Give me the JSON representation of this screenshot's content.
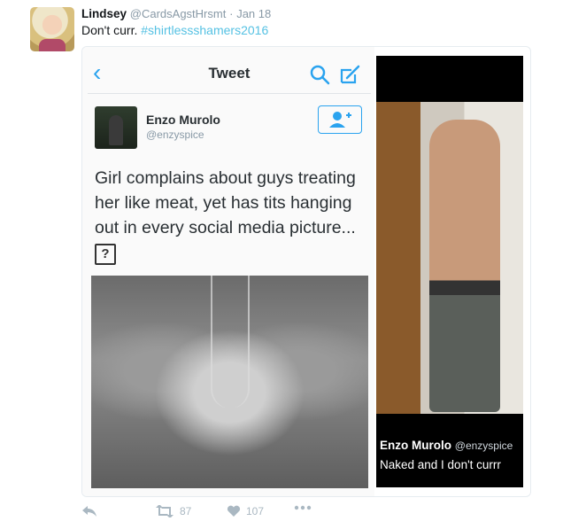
{
  "tweet": {
    "author_name": "Lindsey",
    "author_handle": "@CardsAgstHrsmt",
    "separator": "·",
    "date": "Jan 18",
    "text": "Don't curr.",
    "hashtag": "#shirtlessshamers2016"
  },
  "embedded_left": {
    "nav_title": "Tweet",
    "user_name": "Enzo Murolo",
    "user_handle": "@enzyspice",
    "body": "Girl complains about guys treating her like meat, yet has tits hanging out in every social media picture...",
    "placeholder_glyph": "?"
  },
  "embedded_right": {
    "user_name": "Enzo Murolo",
    "user_handle": "@enzyspice",
    "caption": "Naked and I don't currr"
  },
  "actions": {
    "retweets": "87",
    "likes": "107"
  },
  "colors": {
    "accent": "#2aa3ef",
    "hashtag": "#55c1e3",
    "muted": "#8899a6"
  },
  "icons": [
    "reply-icon",
    "retweet-icon",
    "heart-icon",
    "more-icon",
    "back-chevron-icon",
    "search-icon",
    "compose-icon",
    "follow-user-icon"
  ]
}
